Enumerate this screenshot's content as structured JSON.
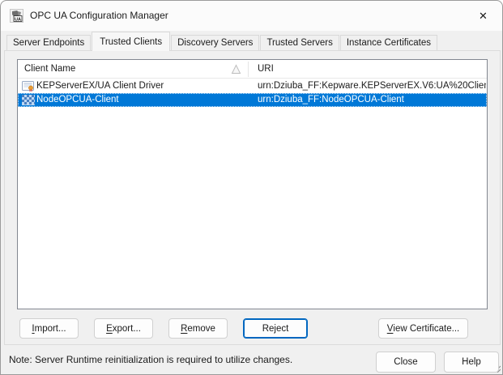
{
  "window": {
    "title": "OPC UA Configuration Manager",
    "close_glyph": "✕"
  },
  "tabs": [
    {
      "label": "Server Endpoints",
      "active": false
    },
    {
      "label": "Trusted Clients",
      "active": true
    },
    {
      "label": "Discovery Servers",
      "active": false
    },
    {
      "label": "Trusted Servers",
      "active": false
    },
    {
      "label": "Instance Certificates",
      "active": false
    }
  ],
  "list": {
    "columns": [
      {
        "label": "Client Name",
        "sort": "ascending"
      },
      {
        "label": "URI",
        "sort": "none"
      }
    ],
    "rows": [
      {
        "client_name": "KEPServerEX/UA Client Driver",
        "uri": "urn:Dziuba_FF:Kepware.KEPServerEX.V6:UA%20Clien...",
        "icon": "certificate-icon",
        "selected": false
      },
      {
        "client_name": "NodeOPCUA-Client",
        "uri": "urn:Dziuba_FF:NodeOPCUA-Client",
        "icon": "pending-certificate-icon",
        "selected": true
      }
    ]
  },
  "action_buttons": {
    "import": {
      "pre": "",
      "u": "I",
      "post": "mport..."
    },
    "export": {
      "pre": "",
      "u": "E",
      "post": "xport..."
    },
    "remove": {
      "pre": "",
      "u": "R",
      "post": "emove"
    },
    "reject": {
      "label": "Reject"
    },
    "view_certificate": {
      "pre": "",
      "u": "V",
      "post": "iew Certificate..."
    }
  },
  "footer": {
    "note": "Note: Server Runtime reinitialization is required to utilize changes.",
    "close": "Close",
    "help": "Help"
  },
  "colors": {
    "selection_bg": "#0078d7",
    "selection_text": "#ffffff",
    "focus_button_border": "#0067c0",
    "window_bg": "#f0f0f0",
    "titlebar_bg": "#fbfbfb"
  }
}
